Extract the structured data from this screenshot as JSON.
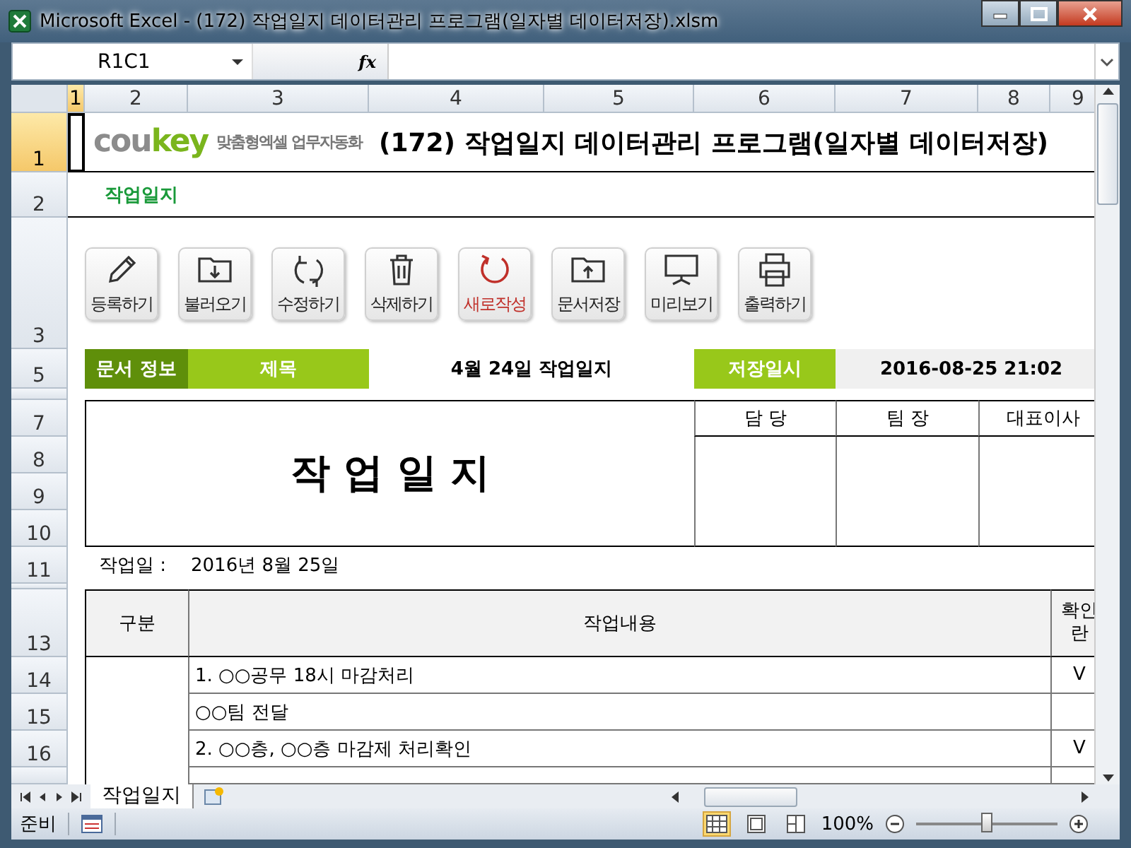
{
  "window": {
    "title": "Microsoft Excel - (172) 작업일지 데이터관리 프로그램(일자별 데이터저장).xlsm"
  },
  "formula_bar": {
    "name_box": "R1C1",
    "function_label": "fx"
  },
  "column_headers": [
    {
      "label": "1",
      "selected": true
    },
    {
      "label": "2",
      "selected": false
    },
    {
      "label": "3",
      "selected": false
    },
    {
      "label": "4",
      "selected": false
    },
    {
      "label": "5",
      "selected": false
    },
    {
      "label": "6",
      "selected": false
    },
    {
      "label": "7",
      "selected": false
    },
    {
      "label": "8",
      "selected": false
    },
    {
      "label": "9",
      "selected": false
    }
  ],
  "row_headers": [
    {
      "label": "1",
      "selected": true
    },
    {
      "label": "2",
      "selected": false
    },
    {
      "label": "3",
      "selected": false
    },
    {
      "label": "5",
      "selected": false
    },
    {
      "label": "7",
      "selected": false
    },
    {
      "label": "8",
      "selected": false
    },
    {
      "label": "9",
      "selected": false
    },
    {
      "label": "10",
      "selected": false
    },
    {
      "label": "11",
      "selected": false
    },
    {
      "label": "13",
      "selected": false
    },
    {
      "label": "14",
      "selected": false
    },
    {
      "label": "15",
      "selected": false
    },
    {
      "label": "16",
      "selected": false
    }
  ],
  "header": {
    "brand_part_1": "cou",
    "brand_part_2": "key",
    "tagline": "맞춤형엑셀 업무자동화",
    "title": "(172) 작업일지 데이터관리 프로그램(일자별 데이터저장)",
    "sheet_label": "작업일지"
  },
  "toolbar": [
    {
      "kind": "pencil",
      "label": "등록하기",
      "accent": false
    },
    {
      "kind": "folder-down",
      "label": "불러오기",
      "accent": false
    },
    {
      "kind": "refresh",
      "label": "수정하기",
      "accent": false
    },
    {
      "kind": "trash",
      "label": "삭제하기",
      "accent": false
    },
    {
      "kind": "circle-arrow",
      "label": "새로작성",
      "accent": true
    },
    {
      "kind": "folder-up",
      "label": "문서저장",
      "accent": false
    },
    {
      "kind": "monitor",
      "label": "미리보기",
      "accent": false
    },
    {
      "kind": "printer",
      "label": "출력하기",
      "accent": false
    }
  ],
  "doc_info": {
    "label": "문서 정보",
    "title_label": "제목",
    "title_value": "4월 24일 작업일지",
    "saved_label": "저장일시",
    "saved_value": "2016-08-25 21:02"
  },
  "form": {
    "heading": "작 업 일 지",
    "approvals": [
      "담 당",
      "팀 장",
      "대표이사"
    ],
    "date_label": "작업일 :",
    "date_value": "2016년 8월 25일",
    "columns": [
      "구분",
      "작업내용",
      "확인란"
    ],
    "rows": [
      {
        "content": "1. ○○공무 18시 마감처리",
        "check": "V"
      },
      {
        "content": "○○팀 전달"
      },
      {
        "content": "2. ○○층, ○○층 마감제 처리확인",
        "check": "V"
      }
    ]
  },
  "sheet_tabs": [
    {
      "label": "작업일지",
      "selected": true
    }
  ],
  "status_bar": {
    "mode": "준비",
    "views": [
      {
        "kind": "normal",
        "selected": true
      },
      {
        "kind": "page-layout",
        "selected": false
      },
      {
        "kind": "page-break",
        "selected": false
      }
    ],
    "zoom": "100%",
    "zoom_slider": {
      "level": 0.5
    }
  }
}
